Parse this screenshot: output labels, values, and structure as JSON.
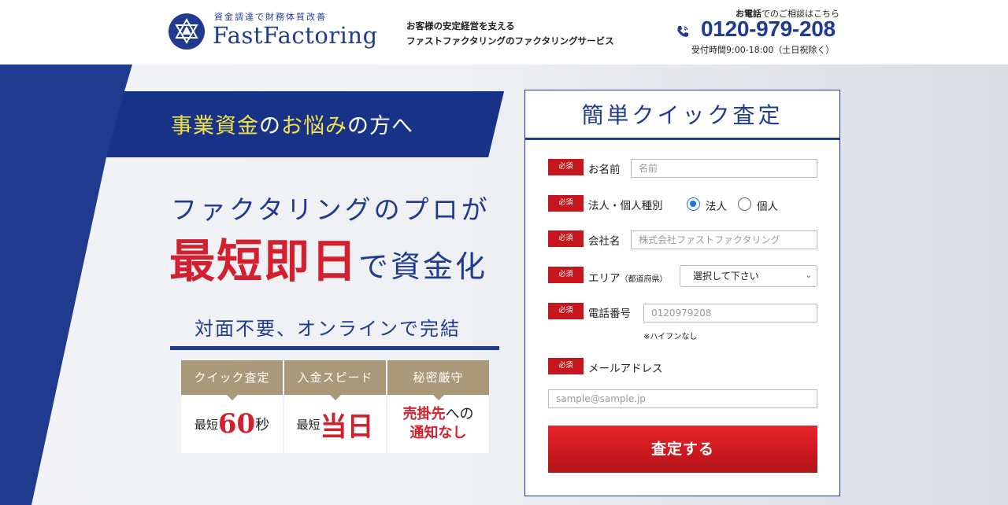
{
  "header": {
    "logo_tagline": "資金調達で財務体質改善",
    "logo_name": "FastFactoring",
    "copy_line1": "お客様の安定経営を支える",
    "copy_line2": "ファストファクタリングのファクタリングサービス",
    "phone_label_bold": "お電話",
    "phone_label_rest": "でのご相談はこちら",
    "phone_number": "0120-979-208",
    "phone_hours": "受付時間9:00-18:00（土日祝除く）"
  },
  "hero": {
    "banner_hl1": "事業資金",
    "banner_mid": "の",
    "banner_hl2": "お悩み",
    "banner_end": "の方へ",
    "headline1": "ファクタリングのプロが",
    "headline2_big": "最短即日",
    "headline2_rest": "で資金化",
    "subhead": "対面不要、オンラインで完結",
    "features": [
      {
        "head": "クイック査定",
        "small": "最短",
        "big": "60",
        "suffix": "秒"
      },
      {
        "head": "入金スピード",
        "small": "最短",
        "big": "当日"
      },
      {
        "head": "秘密厳守",
        "line1_red": "売掛先",
        "line1_end": "への",
        "line2": "通知なし"
      }
    ]
  },
  "form": {
    "title": "簡単クイック査定",
    "required_badge": "必須",
    "name_label": "お名前",
    "name_placeholder": "名前",
    "type_label": "法人・個人種別",
    "type_options": [
      "法人",
      "個人"
    ],
    "type_selected": "法人",
    "company_label": "会社名",
    "company_placeholder": "株式会社ファストファクタリング",
    "area_label": "エリア",
    "area_label_small": "（都道府県）",
    "area_selected": "選択して下さい",
    "phone_label": "電話番号",
    "phone_placeholder": "0120979208",
    "phone_hint": "※ハイフンなし",
    "email_label": "メールアドレス",
    "email_placeholder": "sample@sample.jp",
    "submit_label": "査定する"
  },
  "colors": {
    "navy": "#1f3a8f",
    "red": "#d2202f",
    "gold": "#a99978",
    "yellow": "#f3e34a"
  }
}
